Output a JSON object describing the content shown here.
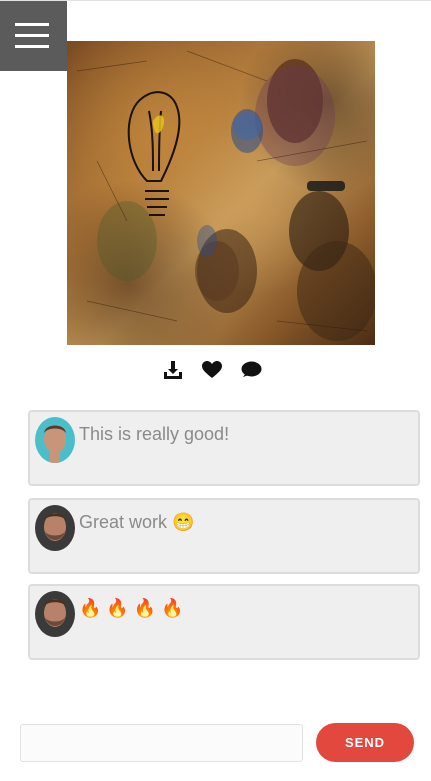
{
  "menu": {
    "icon": "hamburger-menu-icon"
  },
  "artwork": {
    "alt": "Collage artwork with lightbulb sketch and portraits"
  },
  "actions": [
    {
      "icon": "download-icon"
    },
    {
      "icon": "heart-icon"
    },
    {
      "icon": "comment-icon"
    }
  ],
  "comments": [
    {
      "text": "This is really good!",
      "emoji": "",
      "avatar_color": "#4bbfc9"
    },
    {
      "text": "Great work",
      "emoji": "😁",
      "avatar_color": "#3a3a3a"
    },
    {
      "text": "",
      "emoji": "🔥 🔥 🔥 🔥",
      "avatar_color": "#3a3a3a"
    }
  ],
  "composer": {
    "input_value": "",
    "input_placeholder": "",
    "send_label": "SEND"
  },
  "colors": {
    "menu_bg": "#5b5b5b",
    "send_button": "#e2483d",
    "comment_bg": "#efefef",
    "comment_border": "#dcdcdc",
    "comment_text": "#8a8a8a"
  }
}
